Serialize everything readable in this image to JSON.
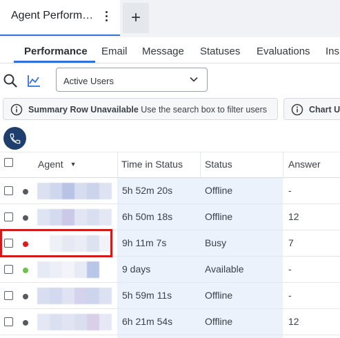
{
  "view_tab": {
    "title": "Agent Perform…",
    "add_label": "+"
  },
  "subtabs": [
    "Performance",
    "Email",
    "Message",
    "Statuses",
    "Evaluations",
    "Ins"
  ],
  "toolbar": {
    "select_value": "Active Users"
  },
  "banners": {
    "summary_bold": "Summary Row Unavailable",
    "summary_text": " Use the search box to filter users",
    "chart_bold": "Chart U"
  },
  "table": {
    "headers": {
      "agent": "Agent",
      "sort_arrow": "▼",
      "time": "Time in Status",
      "status": "Status",
      "answer": "Answer"
    },
    "rows": [
      {
        "time": "5h 52m 20s",
        "status": "Offline",
        "answer": "-",
        "dot": "#555a60"
      },
      {
        "time": "6h 50m 18s",
        "status": "Offline",
        "answer": "12",
        "dot": "#555a60"
      },
      {
        "time": "9h 11m 7s",
        "status": "Busy",
        "answer": "7",
        "dot": "#e01919"
      },
      {
        "time": "9 days",
        "status": "Available",
        "answer": "-",
        "dot": "#6cc24a"
      },
      {
        "time": "5h 59m 11s",
        "status": "Offline",
        "answer": "-",
        "dot": "#555a60"
      },
      {
        "time": "6h 21m 54s",
        "status": "Offline",
        "answer": "12",
        "dot": "#555a60"
      }
    ]
  },
  "colors": {
    "accent": "#2f6fde",
    "phone_bg": "#1e3f6e",
    "highlight": "#d11a1a"
  }
}
